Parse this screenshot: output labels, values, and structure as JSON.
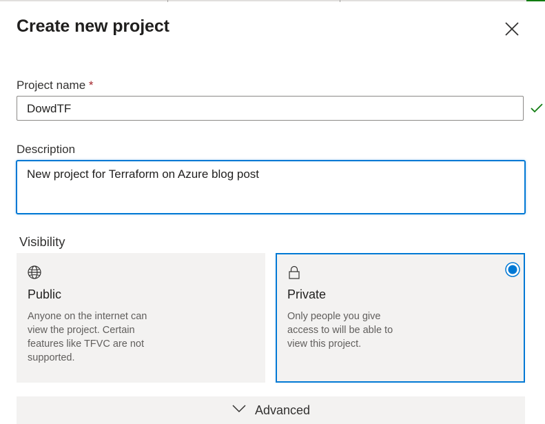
{
  "dialog": {
    "title": "Create new project",
    "close_icon": "close-icon"
  },
  "project_name": {
    "label": "Project name",
    "required_marker": "*",
    "value": "DowdTF",
    "valid_icon": "checkmark-icon"
  },
  "description": {
    "label": "Description",
    "value": "New project for Terraform on Azure blog post"
  },
  "visibility": {
    "label": "Visibility",
    "selected": "Private",
    "options": [
      {
        "icon": "globe-icon",
        "title": "Public",
        "description": "Anyone on the internet can view the project. Certain features like TFVC are not supported."
      },
      {
        "icon": "lock-icon",
        "title": "Private",
        "description": "Only people you give access to will be able to view this project."
      }
    ]
  },
  "advanced": {
    "label": "Advanced",
    "icon": "chevron-down-icon"
  },
  "colors": {
    "accent": "#0078d4",
    "required": "#a4262c",
    "valid": "#107c10",
    "card_bg": "#f3f2f1"
  }
}
